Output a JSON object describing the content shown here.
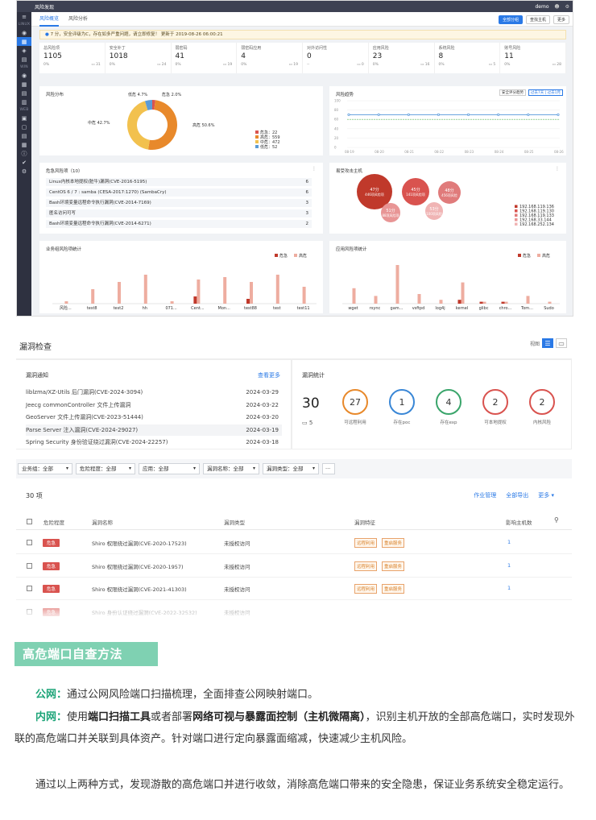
{
  "dashboard": {
    "app_title": "风险发现",
    "user": "demo",
    "tabs": [
      {
        "label": "风险概览"
      },
      {
        "label": "风险分析"
      }
    ],
    "buttons": {
      "all_groups": "全部分组",
      "find_host": "查找主机",
      "more": "更多"
    },
    "nav_sections": [
      "LINUX",
      "WIN",
      "WEB"
    ],
    "notice": "7 分，安全评级为C，存在如多严重问题，请立即修复！ 更新于 2019-08-26 06:00:21",
    "stats": [
      {
        "label": "总风险项",
        "value": "1105",
        "pct": "0%",
        "count": "31"
      },
      {
        "label": "安全补丁",
        "value": "1018",
        "pct": "0%",
        "count": "24"
      },
      {
        "label": "弱密码",
        "value": "41",
        "pct": "0%",
        "count": "19"
      },
      {
        "label": "弱密码应用",
        "value": "4",
        "pct": "0%",
        "count": "19"
      },
      {
        "label": "对外访问性",
        "value": "0",
        "pct": "--",
        "count": "0"
      },
      {
        "label": "应用风险",
        "value": "23",
        "pct": "0%",
        "count": "16"
      },
      {
        "label": "系统风险",
        "value": "8",
        "pct": "0%",
        "count": "5"
      },
      {
        "label": "账号风险",
        "value": "11",
        "pct": "0%",
        "count": "28"
      }
    ],
    "risk_distribution": {
      "title": "风险分布",
      "slices": [
        {
          "name": "危急",
          "pct": "2.0%",
          "count": "22",
          "color": "#d9534f",
          "share": 0.02
        },
        {
          "name": "高危",
          "pct": "50.6%",
          "count": "559",
          "color": "#e8892b",
          "share": 0.506
        },
        {
          "name": "中危",
          "pct": "42.7%",
          "count": "472",
          "color": "#f2c14e",
          "share": 0.427
        },
        {
          "name": "低危",
          "pct": "4.7%",
          "count": "52",
          "color": "#5b9bd5",
          "share": 0.047
        }
      ]
    },
    "risk_trend": {
      "title": "风险趋势",
      "select": "安全评分趋势",
      "range_btn": "过去7天 | 过去1月",
      "y_ticks": [
        "100",
        "80",
        "60",
        "40",
        "20",
        "0"
      ],
      "x_ticks": [
        "08-19",
        "08-20",
        "08-21",
        "08-22",
        "08-23",
        "08-24",
        "08-25",
        "08-26"
      ],
      "values": [
        70,
        70,
        70,
        70,
        70,
        70,
        70,
        70
      ]
    },
    "danger_risks": {
      "title": "危急风险项（10）",
      "items": [
        {
          "name": "Linux内核本地提权(脏牛)漏洞(CVE-2016-5195)",
          "count": "6"
        },
        {
          "name": "CentOS 6 / 7 : samba (CESA-2017:1270) (SambaCry)",
          "count": "6"
        },
        {
          "name": "Bash环境变量远程命令执行漏洞(CVE-2014-7169)",
          "count": "3"
        },
        {
          "name": "匿名访问可写",
          "count": "3"
        },
        {
          "name": "Bash环境变量远程命令执行漏洞(CVE-2014-6271)",
          "count": "2"
        }
      ]
    },
    "attacked_hosts": {
      "title": "易受攻击主机",
      "bubbles": [
        {
          "score": "47分",
          "label": "446项风险项"
        },
        {
          "score": "45分",
          "label": "141项风险项"
        },
        {
          "score": "48分",
          "label": "456项风险"
        },
        {
          "score": "51分",
          "label": "88项风险项"
        },
        {
          "score": "53分",
          "label": "100项风险"
        }
      ],
      "legend": [
        "192.168.119.136",
        "192.168.119.130",
        "192.168.119.133",
        "192.168.33.144",
        "192.168.252.134"
      ]
    },
    "biz_chart": {
      "title": "业务组风险项统计",
      "legend": [
        "危急",
        "高危"
      ],
      "categories": [
        "风险...",
        "test8",
        "test2",
        "hh",
        "071...",
        "Cent...",
        "Mon...",
        "test88",
        "test",
        "test11"
      ]
    },
    "app_chart": {
      "title": "应用风险项统计",
      "legend": [
        "危急",
        "高危"
      ],
      "categories": [
        "wget",
        "rsync",
        "gam...",
        "vsftpd",
        "log4j",
        "kernel",
        "glibc",
        "chro...",
        "Tom...",
        "Sudo"
      ]
    }
  },
  "chart_data": [
    {
      "type": "bar",
      "categories": [
        "风险...",
        "test8",
        "test2",
        "hh",
        "071...",
        "Cent...",
        "Mon...",
        "test88",
        "test",
        "test11"
      ],
      "series": [
        {
          "name": "危急",
          "values": [
            0,
            0,
            0,
            0,
            0,
            3,
            0,
            2,
            0,
            0
          ]
        },
        {
          "name": "高危",
          "values": [
            1,
            6,
            9,
            12,
            1,
            10,
            11,
            9,
            12,
            7
          ]
        }
      ],
      "ylim": [
        0,
        20
      ]
    },
    {
      "type": "bar",
      "categories": [
        "wget",
        "rsync",
        "gam...",
        "vsftpd",
        "log4j",
        "kernel",
        "glibc",
        "chro...",
        "Tom...",
        "Sudo"
      ],
      "series": [
        {
          "name": "危急",
          "values": [
            0,
            0,
            0,
            0,
            0,
            2,
            1,
            1,
            0,
            0
          ]
        },
        {
          "name": "高危",
          "values": [
            8,
            4,
            20,
            5,
            2,
            11,
            1,
            1,
            4,
            1
          ]
        }
      ],
      "ylim": [
        0,
        25
      ]
    }
  ],
  "vuln": {
    "title": "漏洞检查",
    "view_label": "视图",
    "notice_title": "漏洞通知",
    "see_more": "查看更多",
    "notices": [
      {
        "name": "liblzma/XZ-Utils 后门漏洞(CVE-2024-3094)",
        "date": "2024-03-29"
      },
      {
        "name": "Jeecg commonController 文件上传漏洞",
        "date": "2024-03-22"
      },
      {
        "name": "GeoServer 文件上传漏洞(CVE-2023-51444)",
        "date": "2024-03-20"
      },
      {
        "name": "Parse Server 注入漏洞(CVE-2024-29027)",
        "date": "2024-03-19"
      },
      {
        "name": "Spring Security 身份验证绕过漏洞(CVE-2024-22257)",
        "date": "2024-03-18"
      }
    ],
    "stats_title": "漏洞统计",
    "total": "30",
    "sub_count": "5",
    "circles": [
      {
        "value": "27",
        "label": "可远程利用",
        "color": "#e8892b"
      },
      {
        "value": "1",
        "label": "存在poc",
        "color": "#3a87d6"
      },
      {
        "value": "4",
        "label": "存在exp",
        "color": "#3aa56b"
      },
      {
        "value": "2",
        "label": "可本地提权",
        "color": "#d9534f"
      },
      {
        "value": "2",
        "label": "内核风险",
        "color": "#d9534f"
      }
    ],
    "filters": [
      "业务组：全部",
      "危险程度：全部",
      "应用：全部",
      "漏洞名称：全部",
      "漏洞类型：全部"
    ],
    "count_label": "30 项",
    "actions": [
      "作业管理",
      "全部导出",
      "更多"
    ],
    "columns": [
      "危险程度",
      "漏洞名称",
      "漏洞类型",
      "漏洞特征",
      "影响主机数"
    ],
    "rows": [
      {
        "level": "危急",
        "name": "Shiro 权限绕过漏洞(CVE-2020-17523)",
        "type": "未授权访问",
        "features": [
          "远程利用",
          "重启服务"
        ],
        "hosts": "1"
      },
      {
        "level": "危急",
        "name": "Shiro 权限绕过漏洞(CVE-2020-1957)",
        "type": "未授权访问",
        "features": [
          "远程利用",
          "重启服务"
        ],
        "hosts": "1"
      },
      {
        "level": "危急",
        "name": "Shiro 权限绕过漏洞(CVE-2021-41303)",
        "type": "未授权访问",
        "features": [
          "远程利用",
          "重启服务"
        ],
        "hosts": "1"
      },
      {
        "level": "危急",
        "name": "Shiro 身份认证绕过漏洞(CVE-2022-32532)",
        "type": "未授权访问",
        "features": [],
        "hosts": ""
      }
    ]
  },
  "article": {
    "heading": "高危端口自查方法",
    "p1_key": "公网：",
    "p1_text": "通过公网风险端口扫描梳理，全面排查公网映射端口。",
    "p2_key": "内网：",
    "p2_t1": "使用",
    "p2_b1": "端口扫描工具",
    "p2_t2": "或者部署",
    "p2_b2": "网络可视与暴露面控制（主机微隔离）",
    "p2_t3": "，识别主机开放的全部高危端口，实时发现外联的高危端口并关联到具体资产。针对端口进行定向暴露面缩减，快速减少主机风险。",
    "p3_text": "通过以上两种方式，发现游散的高危端口并进行收敛，消除高危端口带来的安全隐患，保证业务系统安全稳定运行。"
  }
}
